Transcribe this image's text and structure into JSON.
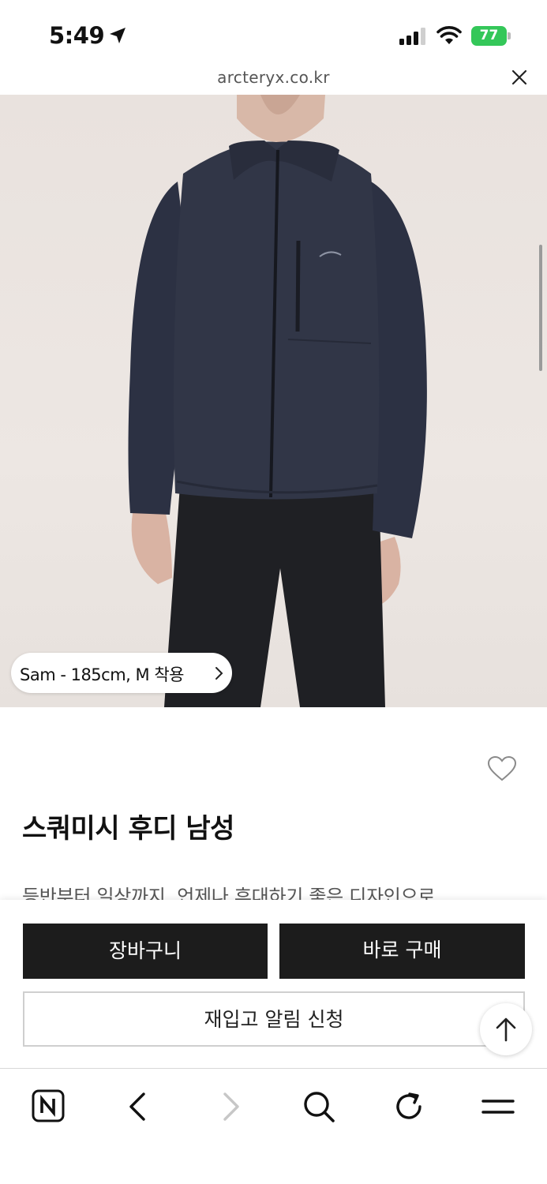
{
  "status_bar": {
    "time": "5:49",
    "battery": "77",
    "battery_color": "#34c759"
  },
  "browser": {
    "url": "arcteryx.co.kr"
  },
  "product": {
    "model_info": "Sam - 185cm, M 착용",
    "title": "스쿼미시 후디 남성",
    "description_partial": "등반부터 일상까지, 언제나 휴대하기 좋은 디자인으로",
    "image_alt": "product-photo"
  },
  "actions": {
    "cart_label": "장바구니",
    "buy_label": "바로 구매",
    "restock_label": "재입고 알림 신청"
  },
  "toolbar": {
    "icons": [
      "naver-icon",
      "back-icon",
      "forward-icon",
      "search-icon",
      "refresh-icon",
      "menu-icon"
    ]
  },
  "colors": {
    "button_dark": "#1c1c1c",
    "background_image": "#ebe4e0",
    "jacket": "#2f3446"
  }
}
